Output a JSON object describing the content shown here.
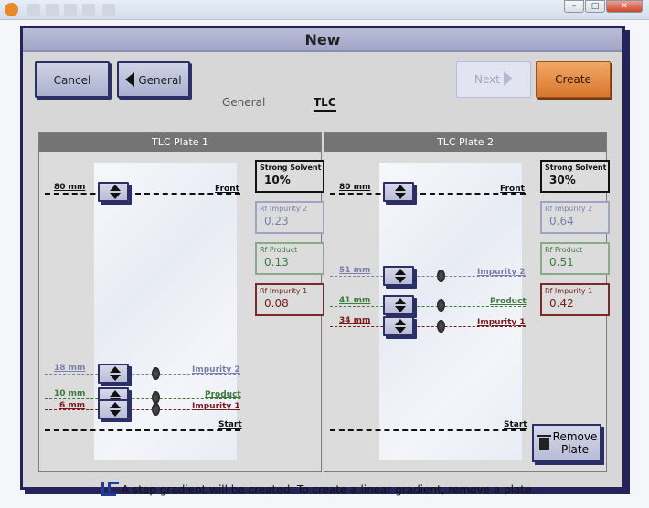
{
  "window": {
    "minimize": "–",
    "maximize": "□",
    "close": "✕"
  },
  "dialog": {
    "title": "New"
  },
  "toolbar": {
    "cancel": "Cancel",
    "general_btn": "General",
    "tab_general": "General",
    "tab_tlc": "TLC",
    "next": "Next",
    "create": "Create"
  },
  "plates": [
    {
      "title": "TLC Plate 1",
      "front": {
        "mm": "80 mm",
        "label": "Front"
      },
      "start": {
        "label": "Start"
      },
      "imp2": {
        "mm": "18 mm",
        "label": "Impurity 2"
      },
      "product": {
        "mm": "10 mm",
        "label": "Product"
      },
      "imp1": {
        "mm": "6 mm",
        "label": "Impurity 1"
      },
      "solvent": {
        "label": "Strong Solvent",
        "value": "10%"
      },
      "rf_imp2": {
        "label": "Rf Impurity 2",
        "value": "0.23"
      },
      "rf_prod": {
        "label": "Rf Product",
        "value": "0.13"
      },
      "rf_imp1": {
        "label": "Rf Impurity 1",
        "value": "0.08"
      }
    },
    {
      "title": "TLC Plate 2",
      "front": {
        "mm": "80 mm",
        "label": "Front"
      },
      "start": {
        "label": "Start"
      },
      "imp2": {
        "mm": "51 mm",
        "label": "Impurity 2"
      },
      "product": {
        "mm": "41 mm",
        "label": "Product"
      },
      "imp1": {
        "mm": "34 mm",
        "label": "Impurity 1"
      },
      "solvent": {
        "label": "Strong Solvent",
        "value": "30%"
      },
      "rf_imp2": {
        "label": "Rf Impurity 2",
        "value": "0.64"
      },
      "rf_prod": {
        "label": "Rf Product",
        "value": "0.51"
      },
      "rf_imp1": {
        "label": "Rf Impurity 1",
        "value": "0.42"
      },
      "remove": "Remove Plate"
    }
  ],
  "footer": {
    "message": "A step gradient will be created. To create a linear gradient, remove a plate."
  },
  "colors": {
    "impurity2": "#7b80ab",
    "product": "#3d7a3d",
    "impurity1": "#7a1a1a",
    "create": "#e98c3f",
    "frame": "#24245a"
  }
}
